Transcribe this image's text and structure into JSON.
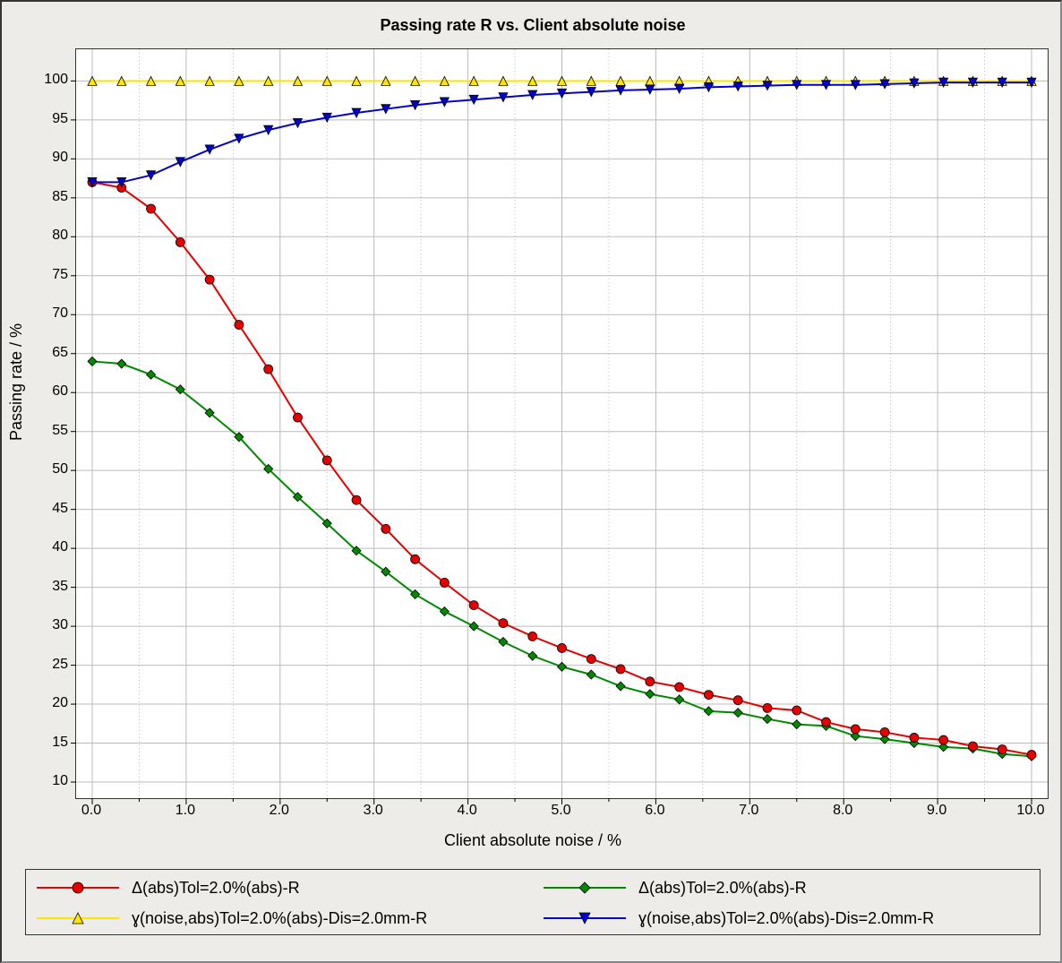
{
  "chart_data": {
    "type": "line",
    "title": "Passing rate R vs. Client absolute noise",
    "xlabel": "Client absolute noise / %",
    "ylabel": "Passing rate / %",
    "xlim": [
      0.0,
      10.0
    ],
    "ylim": [
      10,
      102
    ],
    "x_ticks": [
      0.0,
      1.0,
      2.0,
      3.0,
      4.0,
      5.0,
      6.0,
      7.0,
      8.0,
      9.0,
      10.0
    ],
    "y_ticks": [
      10,
      15,
      20,
      25,
      30,
      35,
      40,
      45,
      50,
      55,
      60,
      65,
      70,
      75,
      80,
      85,
      90,
      95,
      100
    ],
    "x": [
      0.0,
      0.3125,
      0.625,
      0.9375,
      1.25,
      1.5625,
      1.875,
      2.1875,
      2.5,
      2.8125,
      3.125,
      3.4375,
      3.75,
      4.0625,
      4.375,
      4.6875,
      5.0,
      5.3125,
      5.625,
      5.9375,
      6.25,
      6.5625,
      6.875,
      7.1875,
      7.5,
      7.8125,
      8.125,
      8.4375,
      8.75,
      9.0625,
      9.375,
      9.6875,
      10.0
    ],
    "series": [
      {
        "name": "Δ(abs)Tol=2.0%(abs)-R",
        "color": "#e60000",
        "marker": "circle",
        "values": [
          87.0,
          86.3,
          83.6,
          79.3,
          74.5,
          68.7,
          63.0,
          56.8,
          51.3,
          46.2,
          42.5,
          38.6,
          35.6,
          32.7,
          30.4,
          28.7,
          27.2,
          25.8,
          24.5,
          22.9,
          22.2,
          21.2,
          20.5,
          19.5,
          19.2,
          17.7,
          16.8,
          16.4,
          15.7,
          15.4,
          14.6,
          14.2,
          13.5
        ]
      },
      {
        "name": "Δ(abs)Tol=2.0%(abs)-R",
        "color": "#008a00",
        "marker": "diamond",
        "values": [
          64.0,
          63.7,
          62.3,
          60.4,
          57.4,
          54.3,
          50.2,
          46.6,
          43.2,
          39.7,
          37.0,
          34.1,
          31.9,
          30.0,
          28.0,
          26.2,
          24.8,
          23.8,
          22.3,
          21.3,
          20.6,
          19.1,
          18.9,
          18.1,
          17.4,
          17.2,
          15.9,
          15.5,
          15.0,
          14.5,
          14.3,
          13.6,
          13.3
        ]
      },
      {
        "name": "ɣ(noise,abs)Tol=2.0%(abs)-Dis=2.0mm-R",
        "color": "#ffe600",
        "marker": "triangle-up",
        "values": [
          100,
          100,
          100,
          100,
          100,
          100,
          100,
          100,
          100,
          100,
          100,
          100,
          100,
          100,
          100,
          100,
          100,
          100,
          100,
          100,
          100,
          100,
          100,
          100,
          100,
          100,
          100,
          100,
          100,
          100,
          100,
          100,
          100
        ]
      },
      {
        "name": "ɣ(noise,abs)Tol=2.0%(abs)-Dis=2.0mm-R",
        "color": "#0000d0",
        "marker": "triangle-down",
        "values": [
          87.0,
          87.0,
          87.9,
          89.6,
          91.2,
          92.6,
          93.7,
          94.6,
          95.3,
          95.9,
          96.4,
          96.9,
          97.3,
          97.6,
          97.9,
          98.2,
          98.4,
          98.6,
          98.8,
          98.9,
          99.0,
          99.2,
          99.3,
          99.4,
          99.5,
          99.5,
          99.5,
          99.6,
          99.7,
          99.8,
          99.8,
          99.8,
          99.8
        ]
      }
    ],
    "grid": true,
    "legend_position": "bottom"
  }
}
